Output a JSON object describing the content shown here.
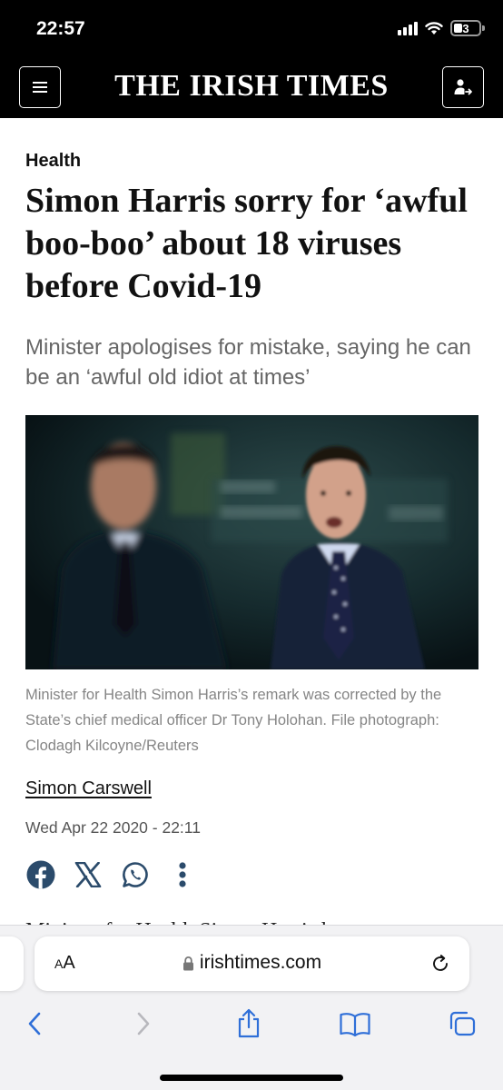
{
  "status_bar": {
    "time": "22:57",
    "battery": "3",
    "icons": [
      "signal-icon",
      "wifi-icon",
      "battery-icon"
    ]
  },
  "header": {
    "masthead": "THE IRISH TIMES",
    "background": "#000000",
    "menu_icon": "hamburger-icon",
    "account_icon": "account-icon"
  },
  "article": {
    "section": "Health",
    "headline": "Simon Harris sorry for ‘awful boo-boo’ about 18 viruses before Covid-19",
    "standfirst": "Minister apologises for mistake, saying he can be an ‘awful old idiot at times’",
    "photo_alt": "Minister for Health Simon Harris speaking at a Government press conference",
    "caption": "Minister for Health Simon Harris’s remark was corrected by the State’s chief medical officer Dr Tony Holohan. File photograph: Clodagh Kilcoyne/Reuters",
    "byline": "Simon Carswell",
    "date": "Wed Apr 22 2020 - 22:11",
    "body_peek": "Minister for Health Simon Harris has"
  },
  "share": {
    "icons": [
      "facebook-icon",
      "x-icon",
      "whatsapp-icon",
      "more-icon"
    ],
    "accent_color": "#2b4b6b"
  },
  "browser": {
    "aa_label_small": "A",
    "aa_label_large": "A",
    "url": "irishtimes.com",
    "lock_icon": "lock-icon",
    "reload_icon": "reload-icon",
    "toolbar_icons": [
      "back-icon",
      "forward-icon",
      "share-icon",
      "bookmarks-icon",
      "tabs-icon"
    ],
    "tint_color": "#2f6fd8"
  }
}
